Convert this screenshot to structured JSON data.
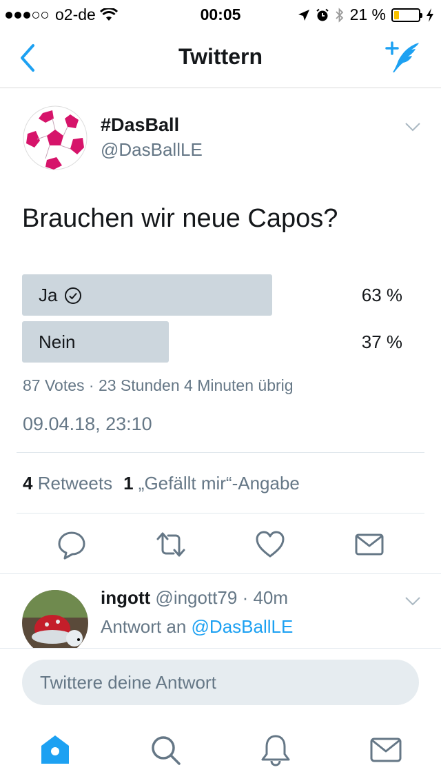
{
  "status_bar": {
    "carrier": "o2-de",
    "time": "00:05",
    "battery": "21 %",
    "battery_level": 0.21,
    "signal_bars": 3
  },
  "nav": {
    "title": "Twittern",
    "back_icon": "chevron-left-icon",
    "compose_icon": "compose-tweet-icon"
  },
  "tweet": {
    "author_name": "#DasBall",
    "author_handle": "@DasBallLE",
    "text": "Brauchen wir neue Capos?",
    "poll": {
      "options": [
        {
          "label": "Ja",
          "percent": "63 %",
          "value": 63,
          "selected": true
        },
        {
          "label": "Nein",
          "percent": "37 %",
          "value": 37,
          "selected": false
        }
      ],
      "meta": "87 Votes · 23 Stunden 4 Minuten übrig"
    },
    "timestamp": "09.04.18, 23:10",
    "retweets_count": "4",
    "retweets_label": "Retweets",
    "likes_count": "1",
    "likes_label": "„Gefällt mir“-Angabe"
  },
  "reply": {
    "name": "ingott",
    "handle_time": "@ingott79 · 40m",
    "reply_prefix": "Antwort an",
    "mention": "@DasBallLE"
  },
  "composer": {
    "placeholder": "Twittere deine Antwort"
  },
  "tabs": [
    "home-icon",
    "search-icon",
    "notifications-icon",
    "messages-icon"
  ],
  "colors": {
    "accent": "#1da1f2",
    "poll_bar": "#ccd6dd",
    "muted_text": "#657786"
  }
}
